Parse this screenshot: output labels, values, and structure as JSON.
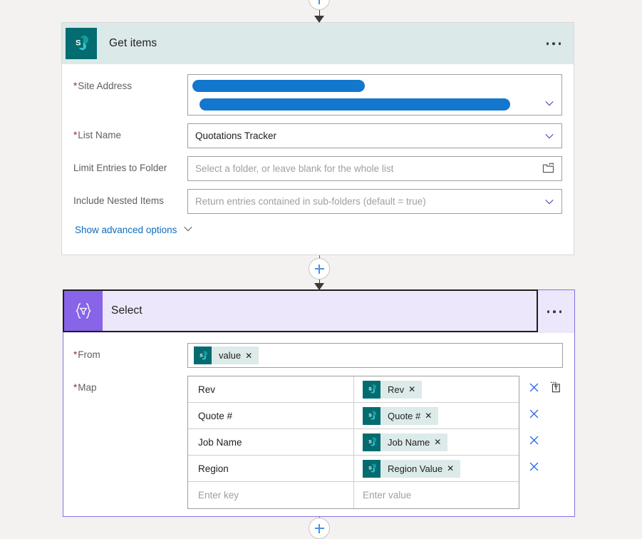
{
  "connectors": {
    "add_label": "+",
    "top": {
      "name": "add-step-top"
    },
    "middle": {
      "name": "add-step-middle"
    },
    "bottom": {
      "name": "add-step-bottom"
    }
  },
  "get_items": {
    "title": "Get items",
    "icon": "sharepoint-icon",
    "more_label": "…",
    "fields": [
      {
        "label": "Site Address",
        "required": true,
        "type": "redacted-combobox",
        "value": "",
        "redacted": true
      },
      {
        "label": "List Name",
        "required": true,
        "type": "combobox",
        "value": "Quotations Tracker",
        "placeholder": ""
      },
      {
        "label": "Limit Entries to Folder",
        "required": false,
        "type": "folder-picker",
        "value": "",
        "placeholder": "Select a folder, or leave blank for the whole list"
      },
      {
        "label": "Include Nested Items",
        "required": false,
        "type": "combobox",
        "value": "",
        "placeholder": "Return entries contained in sub-folders (default = true)"
      }
    ],
    "advanced_link": "Show advanced options"
  },
  "select": {
    "title": "Select",
    "icon": "select-braces-filter-icon",
    "more_label": "…",
    "selected": true,
    "from": {
      "label": "From",
      "required": true,
      "token": {
        "icon": "sharepoint-icon",
        "text": "value",
        "remove": "✕"
      }
    },
    "map": {
      "label": "Map",
      "required": true,
      "key_placeholder": "Enter key",
      "value_placeholder": "Enter value",
      "text_mode_tooltip": "Switch map to text mode",
      "rows": [
        {
          "key": "Rev",
          "token": {
            "icon": "sharepoint-icon",
            "text": "Rev",
            "remove": "✕"
          }
        },
        {
          "key": "Quote #",
          "token": {
            "icon": "sharepoint-icon",
            "text": "Quote #",
            "remove": "✕"
          }
        },
        {
          "key": "Job Name",
          "token": {
            "icon": "sharepoint-icon",
            "text": "Job Name",
            "remove": "✕"
          }
        },
        {
          "key": "Region",
          "token": {
            "icon": "sharepoint-icon",
            "text": "Region Value",
            "remove": "✕"
          }
        }
      ]
    }
  },
  "colors": {
    "sharepoint_teal": "#036c70",
    "get_items_header": "#dbe9e9",
    "select_purple": "#8764e8",
    "select_header": "#ece7fb",
    "accent_blue": "#0f6cbd",
    "redaction_blue": "#1277cd",
    "required_red": "#a4262c",
    "canvas": "#f3f2f1"
  }
}
